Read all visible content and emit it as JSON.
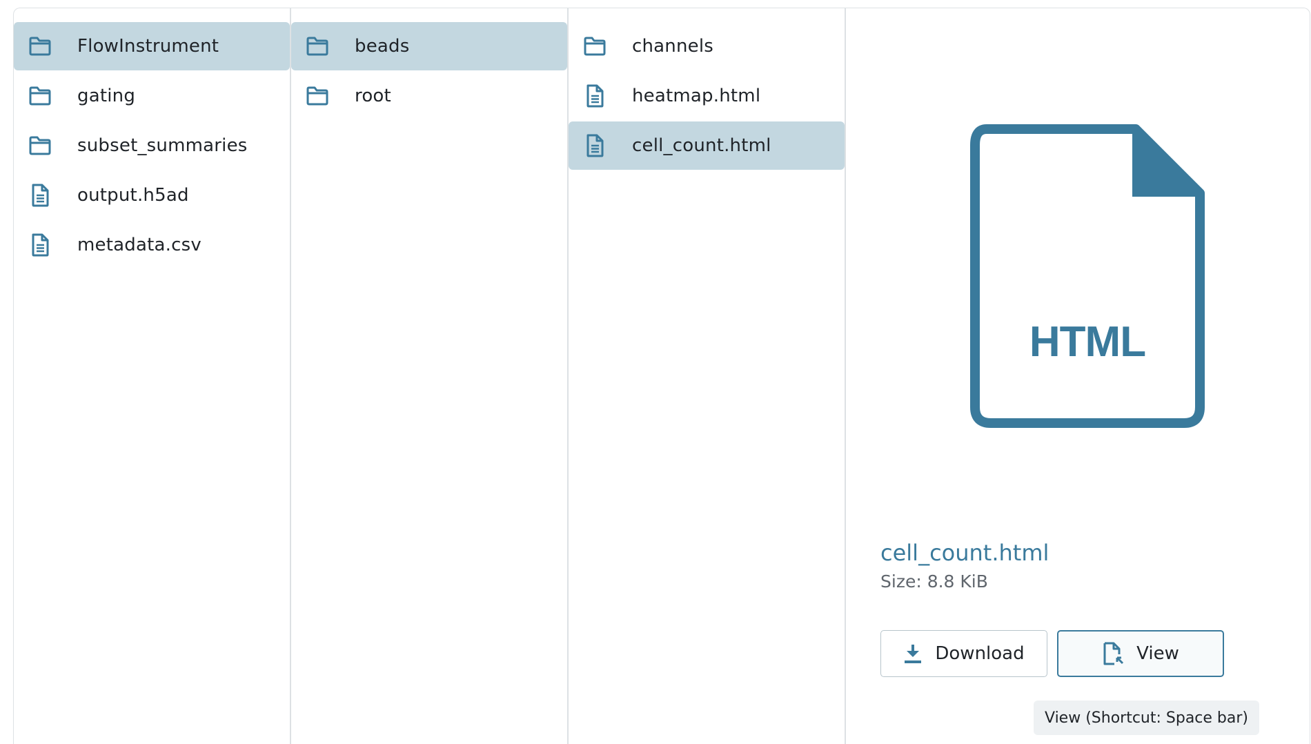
{
  "colors": {
    "accent": "#3a7a9c",
    "selected_bg": "#c3d7e0",
    "border": "#dde1e4"
  },
  "columns": [
    {
      "items": [
        {
          "label": "FlowInstrument",
          "icon": "folder-icon",
          "selected": true
        },
        {
          "label": "gating",
          "icon": "folder-icon",
          "selected": false
        },
        {
          "label": "subset_summaries",
          "icon": "folder-icon",
          "selected": false
        },
        {
          "label": "output.h5ad",
          "icon": "file-icon",
          "selected": false
        },
        {
          "label": "metadata.csv",
          "icon": "file-icon",
          "selected": false
        }
      ]
    },
    {
      "items": [
        {
          "label": "beads",
          "icon": "folder-icon",
          "selected": true
        },
        {
          "label": "root",
          "icon": "folder-icon",
          "selected": false
        }
      ]
    },
    {
      "items": [
        {
          "label": "channels",
          "icon": "folder-icon",
          "selected": false
        },
        {
          "label": "heatmap.html",
          "icon": "file-icon",
          "selected": false
        },
        {
          "label": "cell_count.html",
          "icon": "file-icon",
          "selected": true
        }
      ]
    }
  ],
  "preview": {
    "file_type_label": "HTML",
    "file_name": "cell_count.html",
    "size_text": "Size: 8.8 KiB",
    "download_label": "Download",
    "view_label": "View",
    "tooltip": "View (Shortcut: Space bar)"
  }
}
